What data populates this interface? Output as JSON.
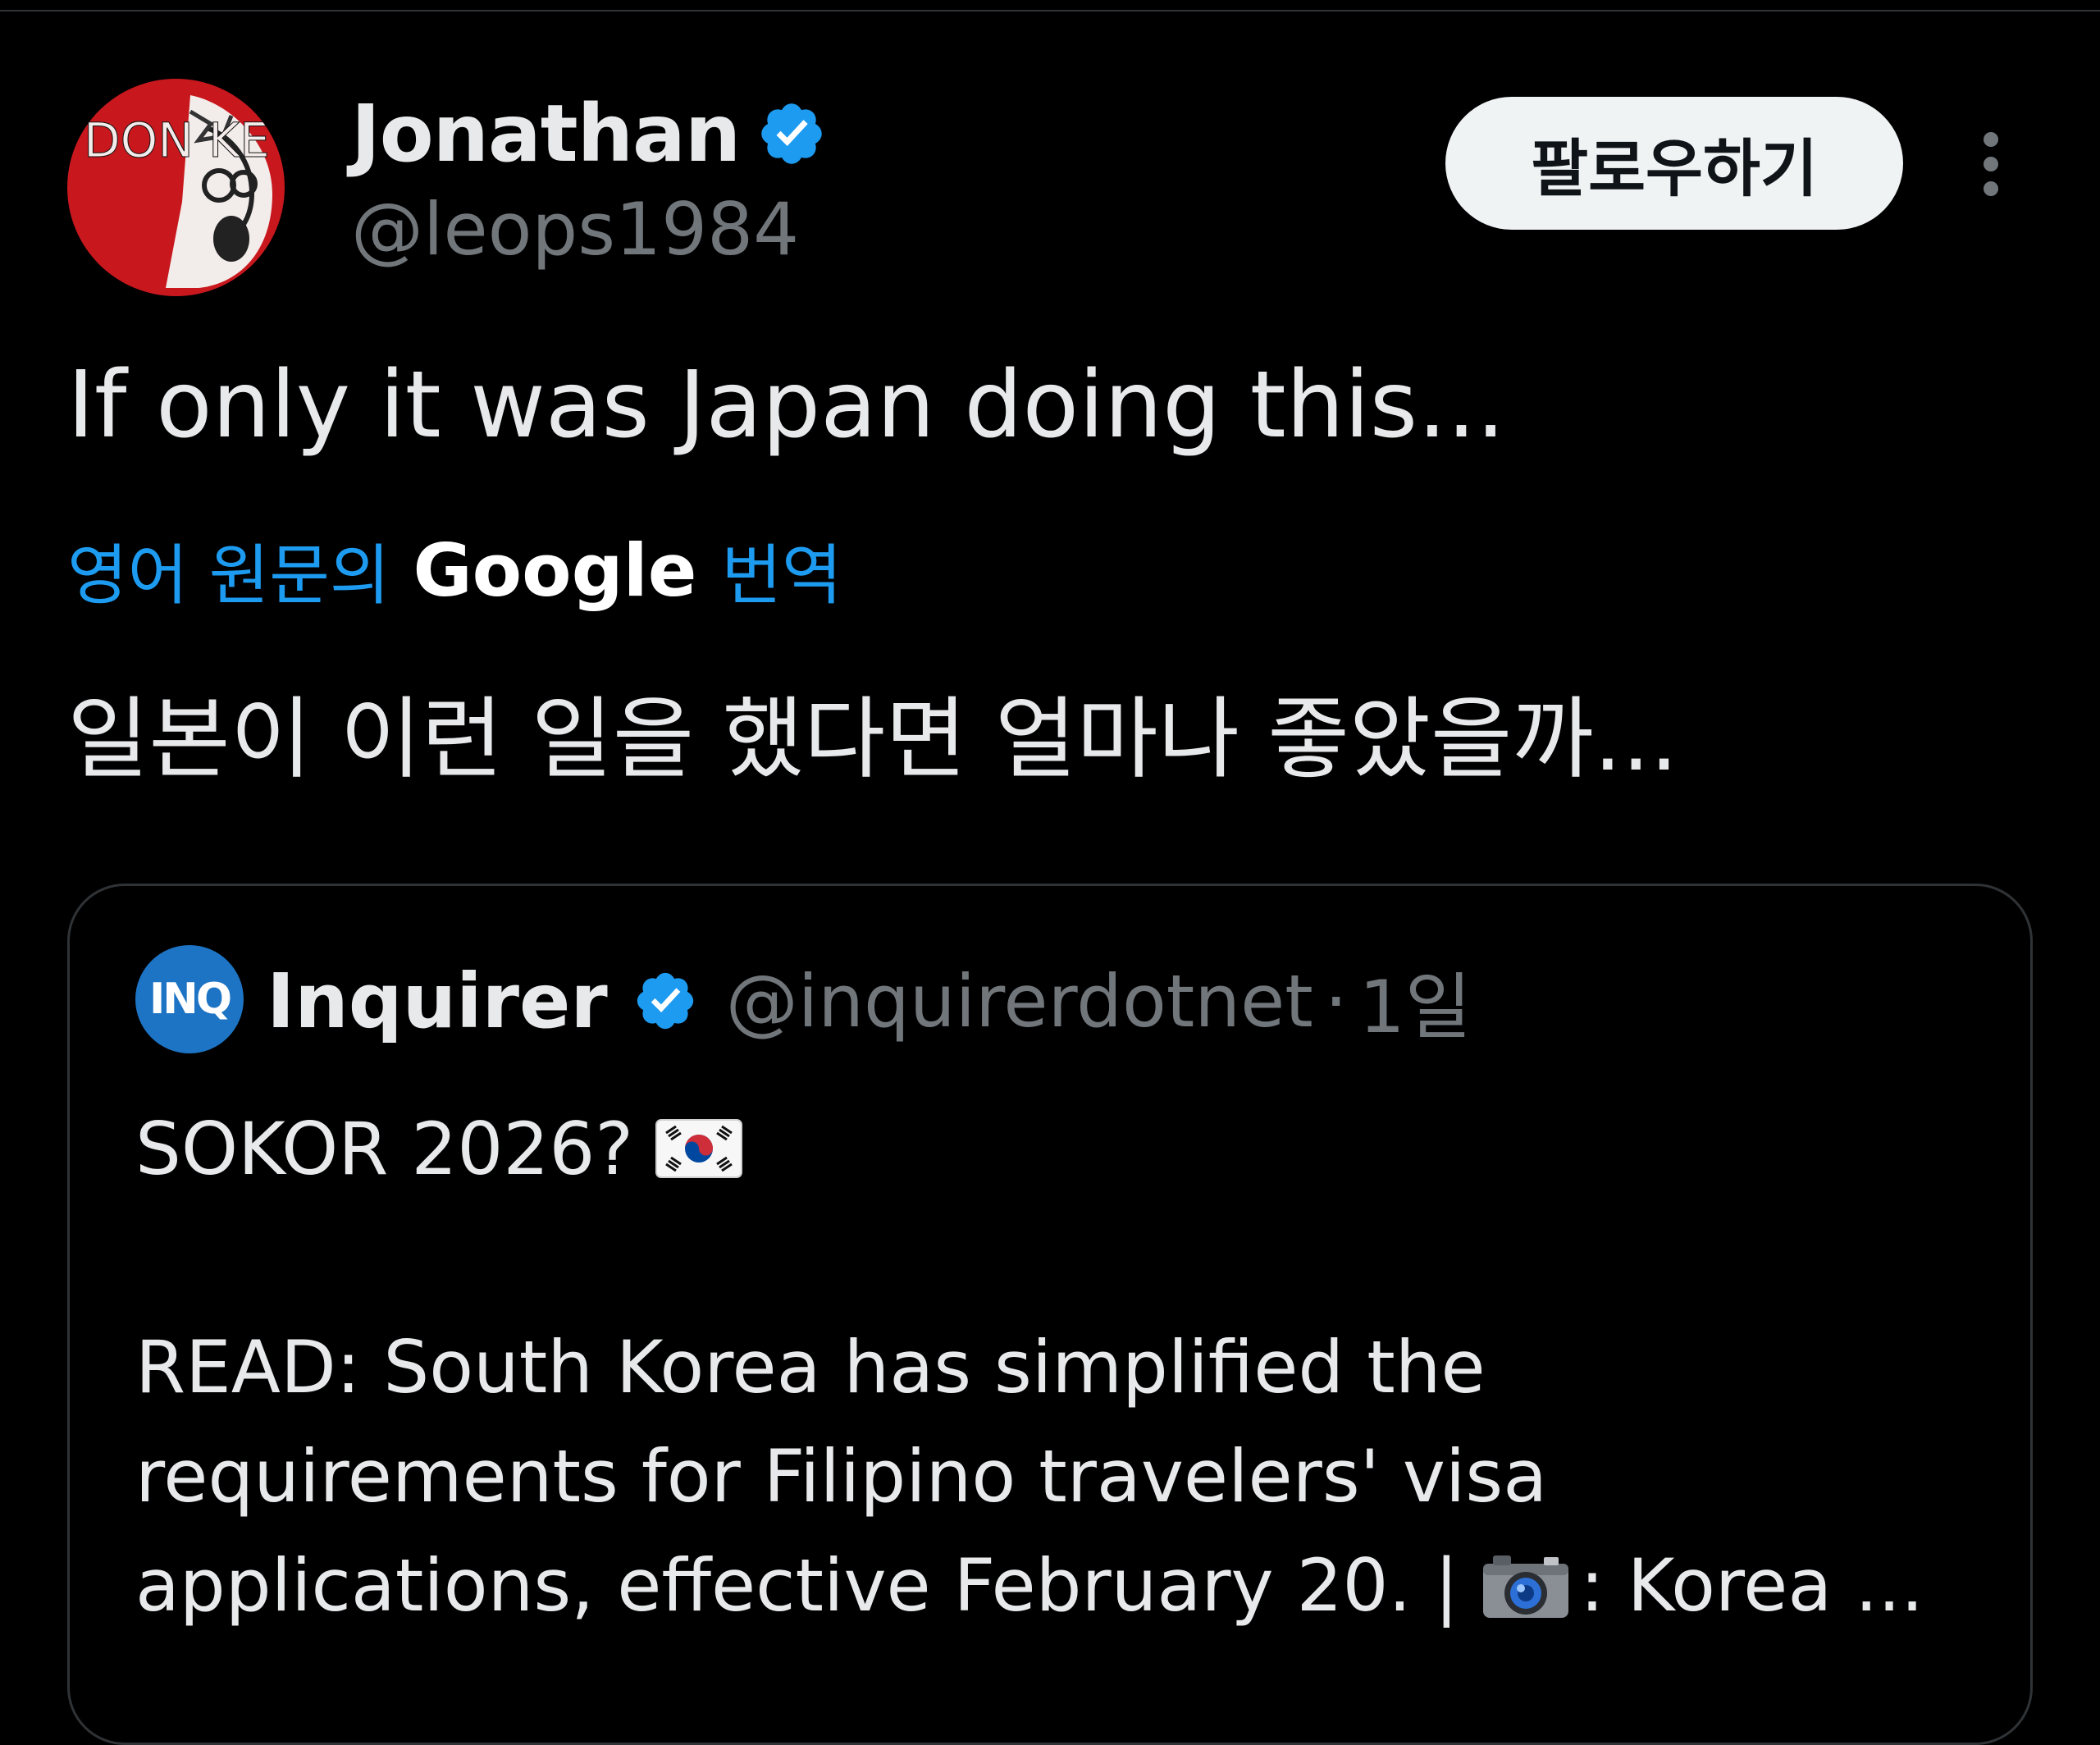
{
  "author": {
    "avatar_text": "DON KEYS",
    "display_name": "Jonathan",
    "handle": "@leops1984",
    "verified_icon": "verified-badge-icon"
  },
  "header": {
    "follow_label": "팔로우하기",
    "more_icon": "more-vertical-icon"
  },
  "tweet": {
    "text": "If only it was Japan doing this..."
  },
  "translation": {
    "label_before": "영어 원문의",
    "provider": "Google",
    "label_after": "번역",
    "translated_text": "일본이 이런 일을 했다면 얼마나 좋았을까..."
  },
  "quoted_tweet": {
    "avatar_text": "INQ",
    "display_name": "Inquirer",
    "handle": "@inquirerdotnet",
    "separator": "·",
    "time": "1일",
    "line1": "SOKOR 2026?",
    "line1_icon": "south-korea-flag-icon",
    "paragraph_line1": "READ: South Korea has simplified the",
    "paragraph_line2": "requirements for Filipino travelers' visa",
    "paragraph_line3_before": "applications, effective February 20. |",
    "paragraph_line3_icon": "camera-icon",
    "paragraph_line3_after": ": Korea ..."
  },
  "colors": {
    "background": "#000000",
    "text_primary": "#e7e9ea",
    "text_secondary": "#71767b",
    "accent_blue": "#1d9bf0",
    "border": "#2f3336",
    "follow_button_bg": "#eff3f4",
    "inq_avatar_bg": "#1d74c4"
  }
}
